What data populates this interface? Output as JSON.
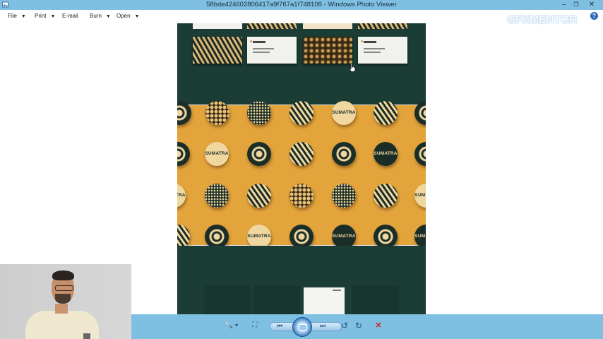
{
  "window": {
    "title": "58bde424602806417a9f767a1f748108 - Windows Photo Viewer",
    "controls": {
      "minimize": "–",
      "restore": "❐",
      "close": "✕"
    }
  },
  "menu": {
    "file": "File",
    "print": "Print",
    "email": "E-mail",
    "burn": "Burn",
    "open": "Open"
  },
  "help_glyph": "?",
  "watermark": "GFXMENTOR",
  "image": {
    "brand_label": "SUMATRA"
  },
  "toolbar": {
    "zoom_glyph": "🔍",
    "zoom_caret": "▾",
    "fit_glyph": "⛶",
    "prev_glyph": "⏮",
    "next_glyph": "⏭",
    "rotate_ccw_glyph": "↺",
    "rotate_cw_glyph": "↻",
    "delete_glyph": "✕"
  },
  "colors": {
    "chrome": "#7fc0e2",
    "image_dark_green": "#1b3d35",
    "image_gold": "#e3a43c",
    "delete_red": "#d42020"
  }
}
